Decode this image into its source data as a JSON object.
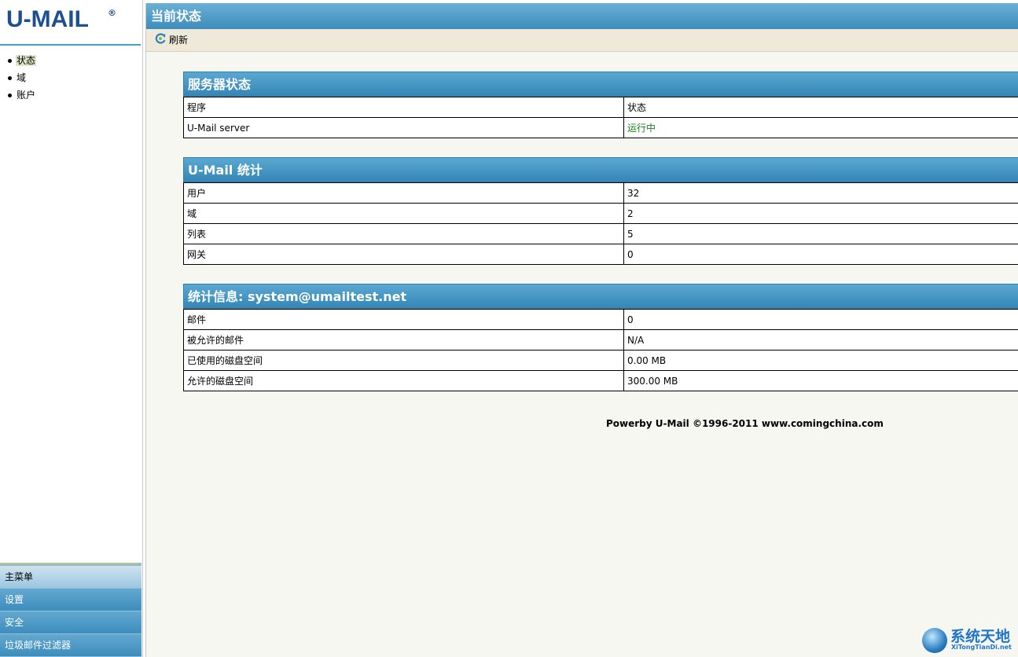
{
  "sidebar": {
    "logo": "U-MAIL",
    "logo_mark": "®",
    "nav": [
      {
        "label": "状态",
        "active": true
      },
      {
        "label": "域",
        "active": false
      },
      {
        "label": "账户",
        "active": false
      }
    ],
    "menu": [
      "主菜单",
      "设置",
      "安全",
      "垃圾邮件过滤器"
    ]
  },
  "header": {
    "title": "当前状态",
    "refresh_label": "刷新"
  },
  "server_status": {
    "title": "服务器状态",
    "header": [
      "程序",
      "状态"
    ],
    "rows": [
      [
        "U-Mail server",
        "运行中"
      ]
    ]
  },
  "umail_stats": {
    "title": "U-Mail 统计",
    "rows": [
      [
        "用户",
        "32"
      ],
      [
        "域",
        "2"
      ],
      [
        "列表",
        "5"
      ],
      [
        "网关",
        "0"
      ]
    ]
  },
  "account_stats": {
    "title": "统计信息: system@umailtest.net",
    "rows": [
      [
        "邮件",
        "0"
      ],
      [
        "被允许的邮件",
        "N/A"
      ],
      [
        "已使用的磁盘空间",
        "0.00 MB"
      ],
      [
        "允许的磁盘空间",
        "300.00 MB"
      ]
    ]
  },
  "footer": "Powerby U-Mail ©1996-2011 www.comingchina.com",
  "watermark": {
    "text": "系统天地",
    "sub": "XiTongTianDi.net"
  },
  "colors": {
    "header_blue": "#3d8cbb",
    "status_ok": "#1a7f1a",
    "logo": "#1d4f91"
  }
}
